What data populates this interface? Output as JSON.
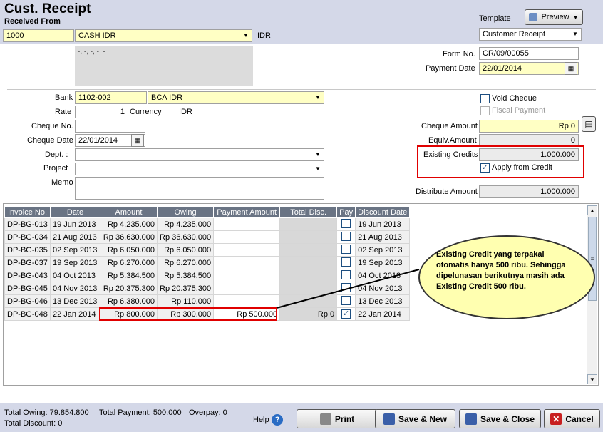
{
  "header": {
    "title": "Cust. Receipt",
    "received_from_label": "Received From",
    "template_label": "Template",
    "preview_label": "Preview",
    "template_value": "Customer Receipt",
    "customer_code": "1000",
    "customer_name": "CASH IDR",
    "currency": "IDR",
    "address_text": "-, -, -, -, -"
  },
  "form": {
    "form_no_label": "Form No.",
    "form_no": "CR/09/00055",
    "payment_date_label": "Payment Date",
    "payment_date": "22/01/2014",
    "bank_label": "Bank",
    "bank_code": "1102-002",
    "bank_name": "BCA IDR",
    "rate_label": "Rate",
    "rate_value": "1",
    "currency_label": "Currency",
    "currency_value": "IDR",
    "cheque_no_label": "Cheque No.",
    "cheque_no": "",
    "cheque_date_label": "Cheque Date",
    "cheque_date": "22/01/2014",
    "dept_label": "Dept. :",
    "project_label": "Project",
    "memo_label": "Memo",
    "void_cheque_label": "Void Cheque",
    "fiscal_payment_label": "Fiscal Payment",
    "cheque_amount_label": "Cheque Amount",
    "cheque_amount": "Rp 0",
    "equiv_amount_label": "Equiv.Amount",
    "equiv_amount": "0",
    "existing_credits_label": "Existing Credits",
    "existing_credits": "1.000.000",
    "apply_from_credit_label": "Apply from Credit",
    "distribute_amount_label": "Distribute Amount",
    "distribute_amount": "1.000.000"
  },
  "table": {
    "headers": [
      "Invoice No.",
      "Date",
      "Amount",
      "Owing",
      "Payment Amount",
      "Total Disc.",
      "Pay",
      "Discount Date"
    ],
    "rows": [
      {
        "inv": "DP-BG-013",
        "date": "19 Jun 2013",
        "amount": "Rp 4.235.000",
        "owing": "Rp 4.235.000",
        "pay_amt": "",
        "disc": "",
        "disc_date": "19 Jun 2013"
      },
      {
        "inv": "DP-BG-034",
        "date": "21 Aug 2013",
        "amount": "Rp 36.630.000",
        "owing": "Rp 36.630.000",
        "pay_amt": "",
        "disc": "",
        "disc_date": "21 Aug 2013"
      },
      {
        "inv": "DP-BG-035",
        "date": "02 Sep 2013",
        "amount": "Rp 6.050.000",
        "owing": "Rp 6.050.000",
        "pay_amt": "",
        "disc": "",
        "disc_date": "02 Sep 2013"
      },
      {
        "inv": "DP-BG-037",
        "date": "19 Sep 2013",
        "amount": "Rp 6.270.000",
        "owing": "Rp 6.270.000",
        "pay_amt": "",
        "disc": "",
        "disc_date": "19 Sep 2013"
      },
      {
        "inv": "DP-BG-043",
        "date": "04 Oct 2013",
        "amount": "Rp 5.384.500",
        "owing": "Rp 5.384.500",
        "pay_amt": "",
        "disc": "",
        "disc_date": "04 Oct 2013"
      },
      {
        "inv": "DP-BG-045",
        "date": "04 Nov 2013",
        "amount": "Rp 20.375.300",
        "owing": "Rp 20.375.300",
        "pay_amt": "",
        "disc": "",
        "disc_date": "04 Nov 2013"
      },
      {
        "inv": "DP-BG-046",
        "date": "13 Dec 2013",
        "amount": "Rp 6.380.000",
        "owing": "Rp 110.000",
        "pay_amt": "",
        "disc": "",
        "disc_date": "13 Dec 2013"
      },
      {
        "inv": "DP-BG-048",
        "date": "22 Jan 2014",
        "amount": "Rp 800.000",
        "owing": "Rp 300.000",
        "pay_amt": "Rp 500.000",
        "disc": "Rp 0",
        "disc_date": "22 Jan 2014"
      }
    ]
  },
  "callout": {
    "text": "Existing Credit yang terpakai otomatis hanya 500 ribu. Sehingga dipelunasan berikutnya masih ada Existing Credit 500 ribu."
  },
  "footer": {
    "total_owing": "Total Owing: 79.854.800",
    "total_payment": "Total Payment: 500.000",
    "overpay": "Overpay: 0",
    "total_discount": "Total Discount: 0",
    "help_label": "Help",
    "print_label": "Print",
    "save_new_label": "Save & New",
    "save_close_label": "Save & Close",
    "cancel_label": "Cancel"
  },
  "colors": {
    "header_band": "#d4d8e8",
    "field_yellow": "#ffffc4",
    "grid_header": "#6a7484",
    "highlight_red": "#e00000",
    "callout_fill": "#ffffb0"
  }
}
